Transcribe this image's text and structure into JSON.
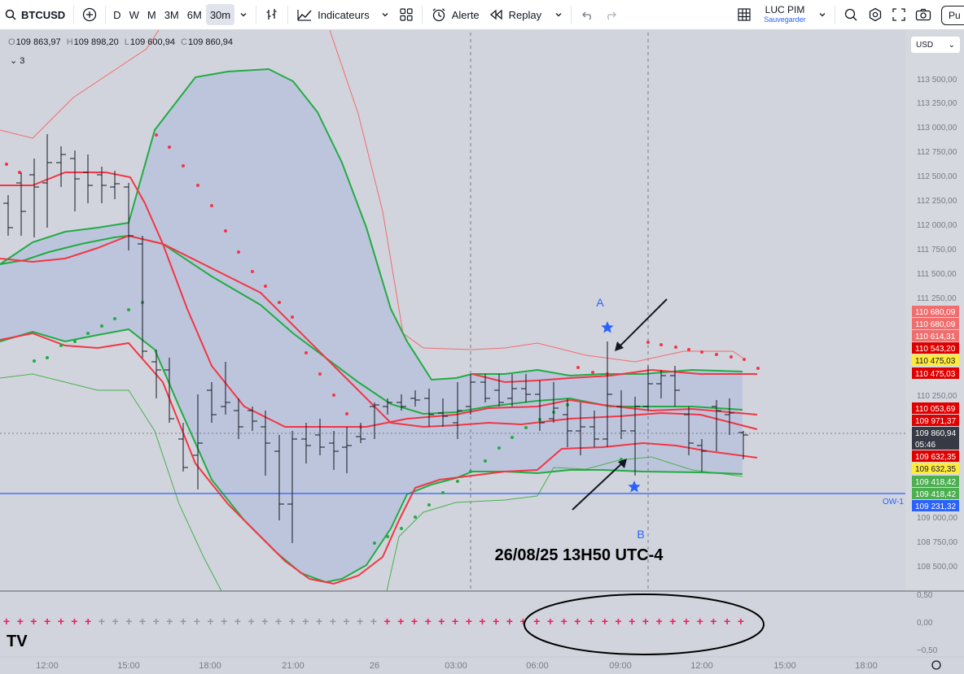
{
  "toolbar": {
    "symbol": "BTCUSD",
    "intervals": [
      "D",
      "W",
      "M",
      "3M",
      "6M",
      "30m"
    ],
    "active_interval": "30m",
    "indicators_label": "Indicateurs",
    "alert_label": "Alerte",
    "replay_label": "Replay",
    "user_name": "LUC PIM",
    "save_label": "Sauvegarder",
    "publish_label": "Pu"
  },
  "legend": {
    "o_key": "O",
    "o_val": "109 863,97",
    "h_key": "H",
    "h_val": "109 898,20",
    "l_key": "L",
    "l_val": "109 600,94",
    "c_key": "C",
    "c_val": "109 860,94",
    "collapse_count": "3"
  },
  "currency": "USD",
  "colors": {
    "background": "#d1d4dc",
    "band_fill": "#b8c1dc",
    "red_line": "#f23645",
    "green_line": "#22ab44",
    "thin_red": "#f26d6d",
    "thin_green": "#4caf50",
    "candle": "#131722",
    "horizontal_line": "#2962ff",
    "annotation_blue": "#2962ff"
  },
  "chart_data": {
    "type": "line",
    "symbol": "BTCUSD",
    "interval": "30m",
    "y_axis_ticks": [
      "113 500,00",
      "113 250,00",
      "113 000,00",
      "112 750,00",
      "112 500,00",
      "112 250,00",
      "112 000,00",
      "111 750,00",
      "111 500,00",
      "111 250,00",
      "110 250,00",
      "109 000,00",
      "108 750,00",
      "108 500,00"
    ],
    "x_axis_ticks": [
      "12:00",
      "15:00",
      "18:00",
      "21:00",
      "26",
      "03:00",
      "06:00",
      "09:00",
      "12:00",
      "15:00",
      "18:00"
    ],
    "ylim": [
      108400,
      113700
    ],
    "price_labels": [
      {
        "text": "110 680,09",
        "color": "#f26d6d"
      },
      {
        "text": "110 680,09",
        "color": "#f26d6d"
      },
      {
        "text": "110 614,31",
        "color": "#f26d6d"
      },
      {
        "text": "110 543,20",
        "color": "#e00000"
      },
      {
        "text": "110 475,03",
        "color": "#ffeb3b"
      },
      {
        "text": "110 475,03",
        "color": "#e00000"
      },
      {
        "text": "110 053,69",
        "color": "#e00000"
      },
      {
        "text": "109 971,37",
        "color": "#e00000"
      },
      {
        "text": "109 860,94",
        "color": "#363a45"
      },
      {
        "text": "05:46",
        "color": "#363a45"
      },
      {
        "text": "109 632,35",
        "color": "#e00000"
      },
      {
        "text": "109 632,35",
        "color": "#ffeb3b"
      },
      {
        "text": "109 418,42",
        "color": "#4caf50"
      },
      {
        "text": "109 418,42",
        "color": "#4caf50"
      },
      {
        "text": "109 231,32",
        "color": "#2962ff"
      }
    ],
    "horizontal_line": {
      "price": 109231.32,
      "label": "OW-1"
    },
    "bands": {
      "red_upper": [
        111700,
        111650,
        111700,
        111800,
        111900,
        111950,
        112000,
        112000,
        111900,
        111300,
        110800,
        110400,
        110200,
        110100,
        110060,
        110060,
        110050,
        110050,
        110060,
        110050,
        110060,
        110050,
        110040
      ],
      "red_mid": [
        111300,
        111250,
        111250,
        111300,
        111300,
        111150,
        110900,
        110650,
        110400,
        110200,
        110000,
        109950,
        109950,
        109950,
        109960,
        110000,
        110000,
        109980,
        109970,
        109980,
        109960,
        109970,
        109950
      ]
    },
    "annotations": [
      {
        "text": "A"
      },
      {
        "text": "B"
      },
      {
        "text": "26/08/25 13H50 UTC-4"
      }
    ],
    "oscillator": {
      "ticks": [
        "0,50",
        "0,00",
        "−0,50"
      ]
    }
  }
}
